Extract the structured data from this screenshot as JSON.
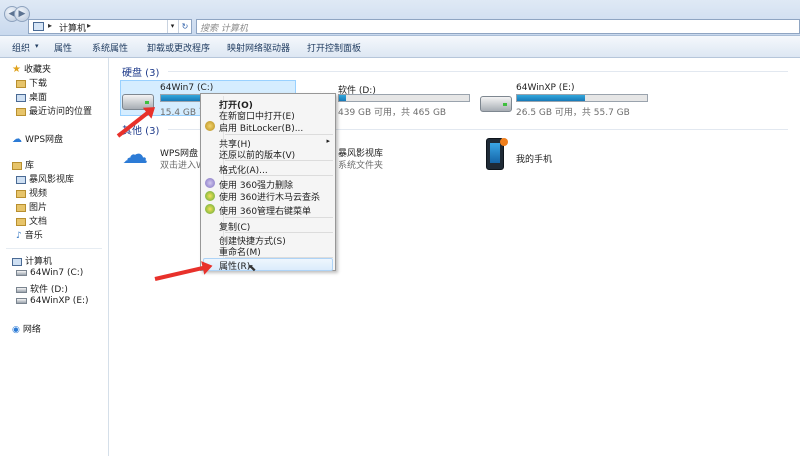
{
  "address": {
    "path": "计算机",
    "search_placeholder": "搜索 计算机"
  },
  "toolbar": [
    "组织",
    "属性",
    "系统属性",
    "卸载或更改程序",
    "映射网络驱动器",
    "打开控制面板"
  ],
  "sidebar": {
    "favorites": {
      "title": "收藏夹",
      "items": [
        "下载",
        "桌面",
        "最近访问的位置"
      ]
    },
    "wps": "WPS网盘",
    "library": {
      "title": "库",
      "items": [
        "暴风影视库",
        "视频",
        "图片",
        "文档",
        "音乐"
      ]
    },
    "computer": {
      "title": "计算机",
      "items": [
        "64Win7  (C:)",
        "软件 (D:)",
        "64WinXP  (E:)"
      ]
    },
    "network": "网络"
  },
  "main": {
    "hdd_group": "硬盘 (3)",
    "other_group": "其他 (3)",
    "drives": [
      {
        "name": "64Win7  (C:)",
        "info": "15.4 GB 可用",
        "fill": 0.75
      },
      {
        "name": "软件 (D:)",
        "info": "439 GB 可用，共 465 GB",
        "fill": 0.05
      },
      {
        "name": "64WinXP  (E:)",
        "info": "26.5 GB 可用，共 55.7 GB",
        "fill": 0.52
      }
    ],
    "others": [
      {
        "name": "WPS网盘",
        "desc": "双击进入WPS网盘"
      },
      {
        "name": "暴风影视库",
        "desc": "系统文件夹"
      },
      {
        "name": "我的手机",
        "desc": ""
      }
    ]
  },
  "context_menu": {
    "items": [
      "打开(O)",
      "在新窗口中打开(E)",
      "启用 BitLocker(B)...",
      "共享(H)",
      "还原以前的版本(V)",
      "格式化(A)...",
      "使用 360强力删除",
      "使用 360进行木马云查杀",
      "使用 360管理右键菜单",
      "复制(C)",
      "创建快捷方式(S)",
      "重命名(M)",
      "属性(R)"
    ]
  }
}
